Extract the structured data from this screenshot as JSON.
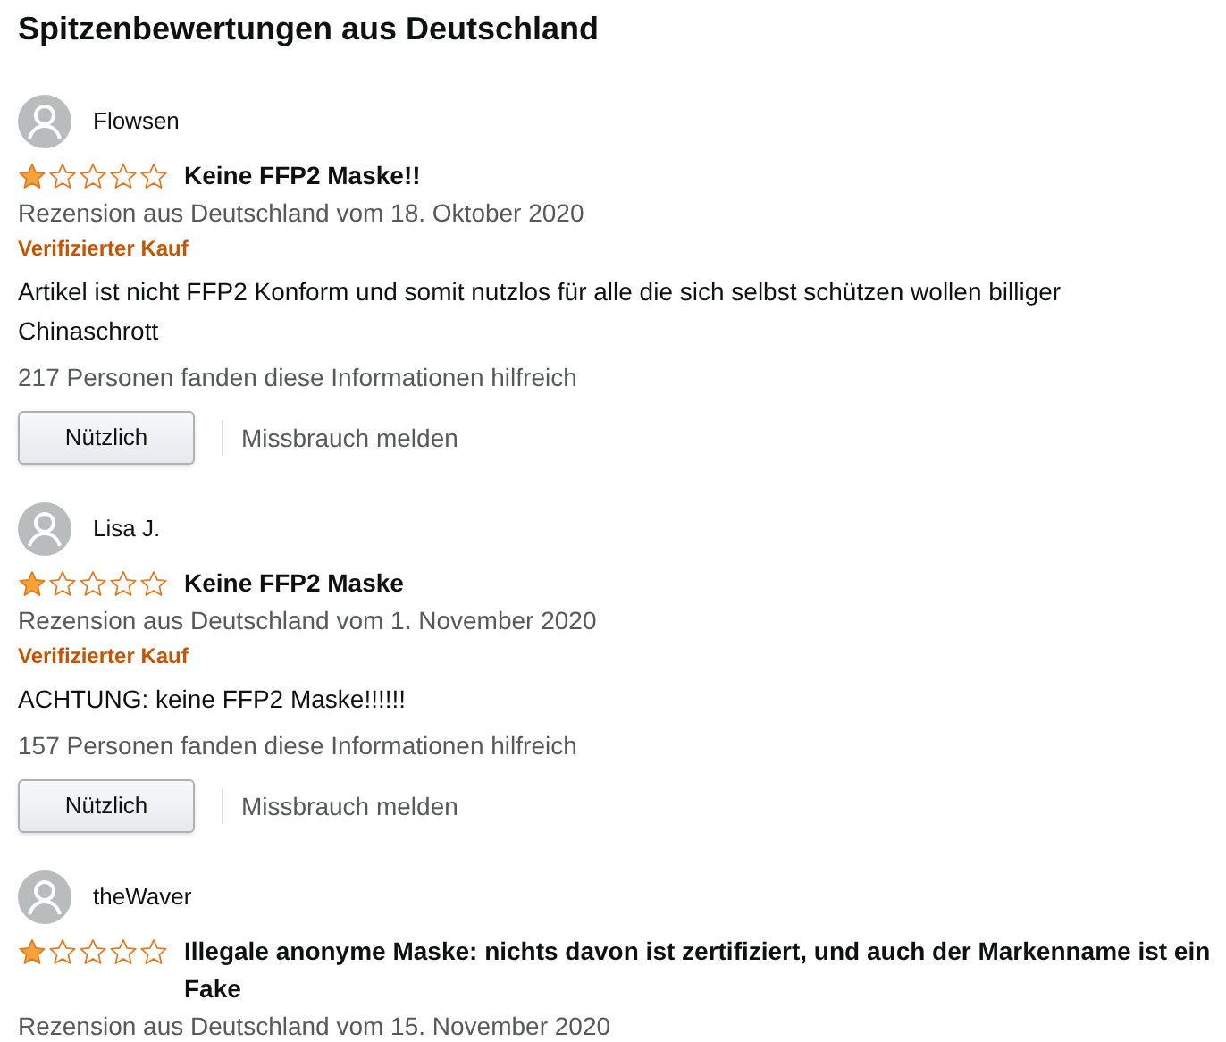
{
  "heading": "Spitzenbewertungen aus Deutschland",
  "reviews": [
    {
      "author": "Flowsen",
      "stars": 1,
      "title": "Keine FFP2 Maske!!",
      "date": "Rezension aus Deutschland vom 18. Oktober 2020",
      "badge": "Verifizierter Kauf",
      "body": "Artikel ist nicht FFP2 Konform und somit nutzlos für alle die sich selbst schützen wollen billiger Chinaschrott",
      "helpful": "217 Personen fanden diese Informationen hilfreich",
      "helpful_button": "Nützlich",
      "report": "Missbrauch melden"
    },
    {
      "author": "Lisa J.",
      "stars": 1,
      "title": "Keine FFP2 Maske",
      "date": "Rezension aus Deutschland vom 1. November 2020",
      "badge": "Verifizierter Kauf",
      "body": "ACHTUNG: keine FFP2 Maske!!!!!!",
      "helpful": "157 Personen fanden diese Informationen hilfreich",
      "helpful_button": "Nützlich",
      "report": "Missbrauch melden"
    },
    {
      "author": "theWaver",
      "stars": 1,
      "title": "Illegale anonyme Maske: nichts davon ist zertifiziert, und auch der Markenname ist ein Fake",
      "date": "Rezension aus Deutschland vom 15. November 2020"
    }
  ]
}
